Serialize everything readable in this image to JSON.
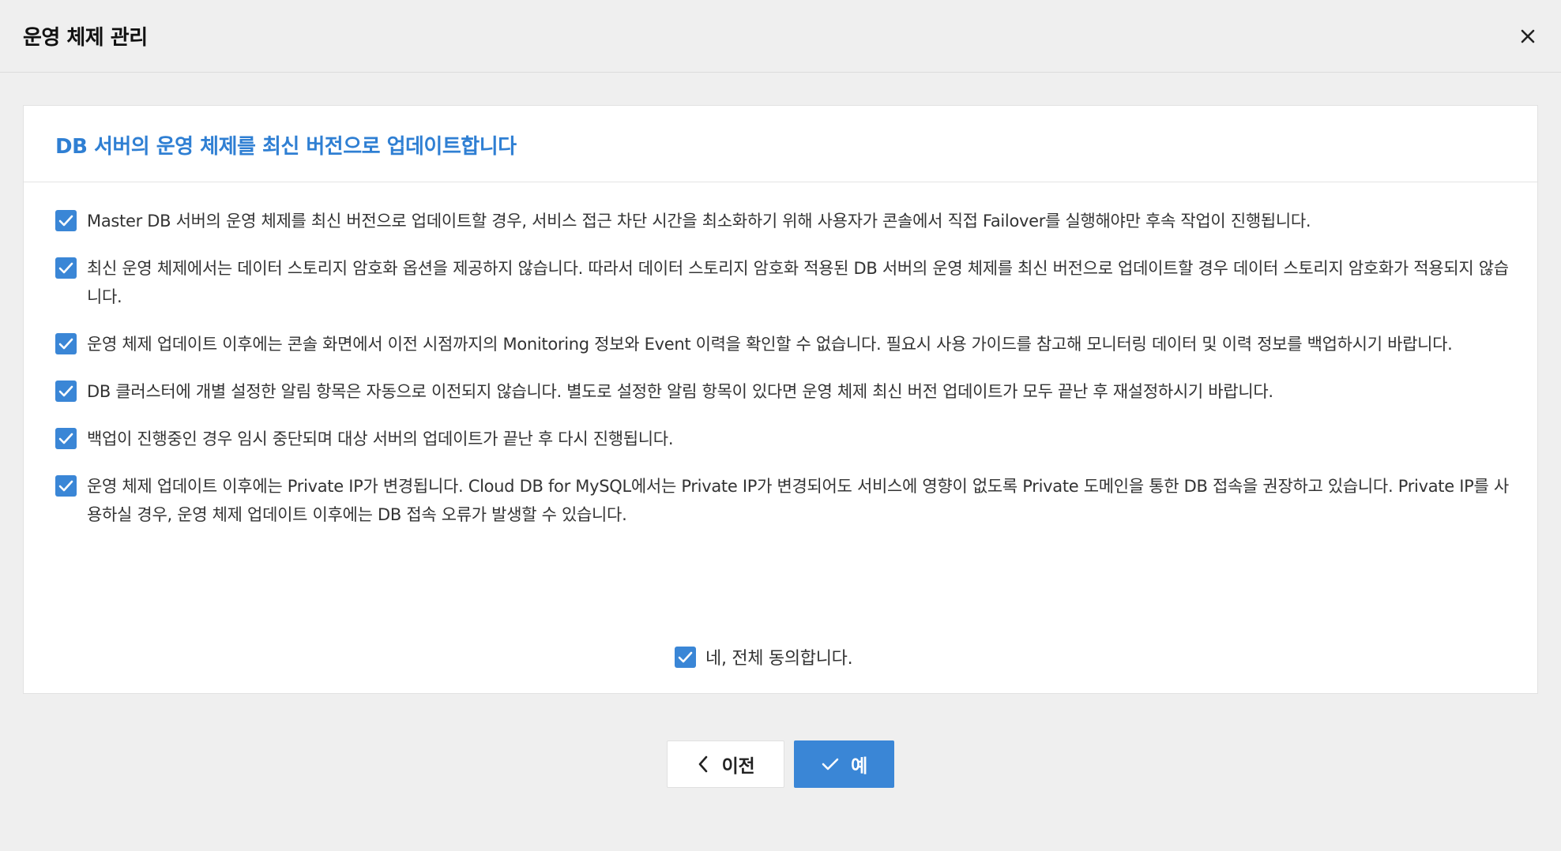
{
  "dialog": {
    "title": "운영 체제 관리",
    "close_icon": "close-icon"
  },
  "card": {
    "title": "DB 서버의 운영 체제를 최신 버전으로 업데이트합니다",
    "title_color": "#2f7fd3",
    "items": [
      {
        "checked": true,
        "text": "Master DB 서버의 운영 체제를 최신 버전으로 업데이트할 경우, 서비스 접근 차단 시간을 최소화하기 위해 사용자가 콘솔에서 직접 Failover를 실행해야만 후속 작업이 진행됩니다."
      },
      {
        "checked": true,
        "text": "최신 운영 체제에서는 데이터 스토리지 암호화 옵션을 제공하지 않습니다. 따라서 데이터 스토리지 암호화 적용된 DB 서버의 운영 체제를 최신 버전으로 업데이트할 경우 데이터 스토리지 암호화가 적용되지 않습니다."
      },
      {
        "checked": true,
        "text": "운영 체제 업데이트 이후에는 콘솔 화면에서 이전 시점까지의 Monitoring 정보와 Event 이력을 확인할 수 없습니다. 필요시 사용 가이드를 참고해 모니터링 데이터 및 이력 정보를 백업하시기 바랍니다."
      },
      {
        "checked": true,
        "text": "DB 클러스터에 개별 설정한 알림 항목은 자동으로 이전되지 않습니다. 별도로 설정한 알림 항목이 있다면 운영 체제 최신 버전 업데이트가 모두 끝난 후 재설정하시기 바랍니다."
      },
      {
        "checked": true,
        "text": "백업이 진행중인 경우 임시 중단되며 대상 서버의 업데이트가 끝난 후 다시 진행됩니다."
      },
      {
        "checked": true,
        "text": "운영 체제 업데이트 이후에는 Private IP가 변경됩니다. Cloud DB for MySQL에서는 Private IP가 변경되어도 서비스에 영향이 없도록 Private 도메인을 통한 DB 접속을 권장하고 있습니다. Private IP를 사용하실 경우, 운영 체제 업데이트 이후에는 DB 접속 오류가 발생할 수 있습니다."
      }
    ],
    "agree_all": {
      "checked": true,
      "label": "네, 전체 동의합니다."
    }
  },
  "footer": {
    "prev_label": "이전",
    "prev_icon": "chevron-left-icon",
    "confirm_label": "예",
    "confirm_icon": "check-icon",
    "accent_color": "#3a86d6"
  }
}
